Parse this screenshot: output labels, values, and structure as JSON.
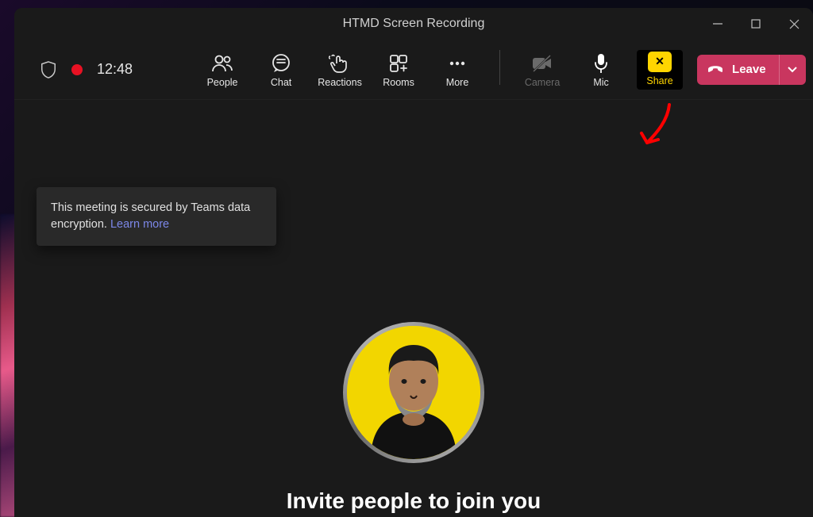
{
  "window": {
    "title": "HTMD Screen Recording"
  },
  "meeting": {
    "timer": "12:48"
  },
  "toolbar": {
    "people": "People",
    "chat": "Chat",
    "reactions": "Reactions",
    "rooms": "Rooms",
    "more": "More",
    "camera": "Camera",
    "mic": "Mic",
    "share": "Share",
    "leave": "Leave"
  },
  "tooltip": {
    "text": "This meeting is secured by Teams data encryption. ",
    "link": "Learn more"
  },
  "main": {
    "heading": "Invite people to join you"
  },
  "colors": {
    "accent_yellow": "#ffd500",
    "leave_red": "#c9365f",
    "link": "#7c87e8",
    "record": "#e81123"
  }
}
